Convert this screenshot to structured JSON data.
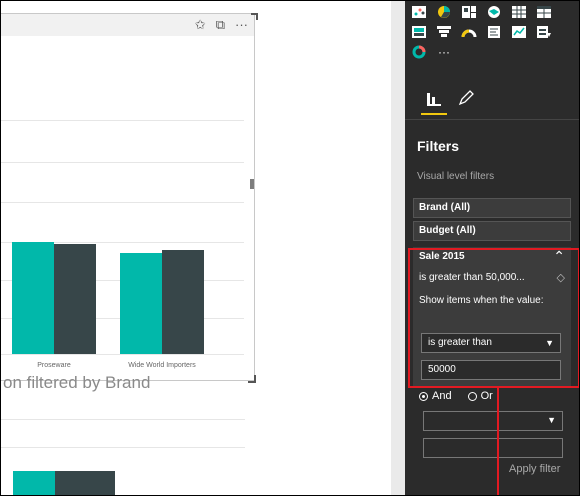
{
  "visual_header": {
    "icons": [
      "pin-icon",
      "focus-mode-icon",
      "more-options-icon"
    ]
  },
  "chart_data": {
    "type": "bar",
    "categories": [
      "Proseware",
      "Wide World Importers"
    ],
    "series": [
      {
        "color": "#01b8aa",
        "values": [
          0.7,
          0.63
        ]
      },
      {
        "color": "#374649",
        "values": [
          0.69,
          0.65
        ]
      }
    ],
    "title": "",
    "xlabel": "",
    "ylabel": "",
    "grid": true
  },
  "visual2": {
    "title": "on filtered by Brand"
  },
  "pane": {
    "visualization_icons": [
      "scatter-chart-icon",
      "pie-chart-icon",
      "treemap-icon",
      "map-icon",
      "table-icon",
      "matrix-icon",
      "card-icon",
      "funnel-icon",
      "gauge-icon",
      "multi-row-card-icon",
      "kpi-icon",
      "slicer-icon",
      "donut-chart-icon",
      "more-visuals-icon"
    ],
    "tabs": [
      "fields-tab-icon",
      "format-tab-icon"
    ],
    "filters_title": "Filters",
    "visual_level_filters": "Visual level filters",
    "filters": [
      {
        "label": "Brand (All)"
      },
      {
        "label": "Budget (All)"
      }
    ],
    "sale_filter": {
      "title": "Sale 2015",
      "condition": "is greater than 50,000...",
      "show_items_text": "Show items when the value:",
      "operator": "is greater than",
      "value": "50000",
      "and_label": "And",
      "or_label": "Or",
      "apply_label": "Apply filter"
    }
  },
  "colors": {
    "highlight": "#e21a22",
    "teal": "#01b8aa",
    "dark": "#374649",
    "pane_bg": "#2b2b2b"
  }
}
